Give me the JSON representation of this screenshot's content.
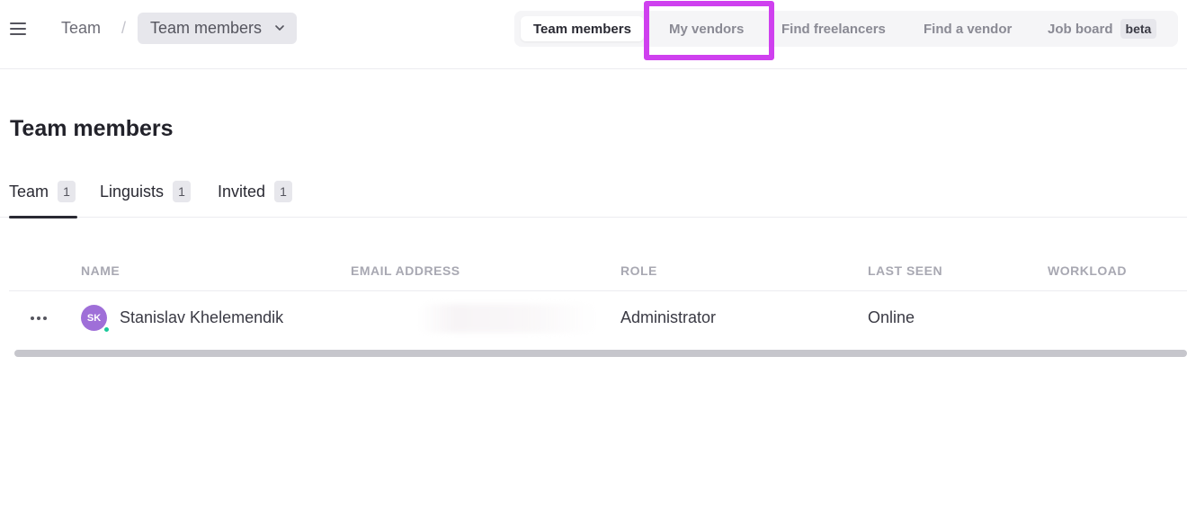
{
  "header": {
    "breadcrumb_root": "Team",
    "breadcrumb_separator": "/",
    "breadcrumb_current": "Team members",
    "nav": [
      {
        "label": "Team members",
        "active": true
      },
      {
        "label": "My vendors",
        "active": false
      },
      {
        "label": "Find freelancers",
        "active": false
      },
      {
        "label": "Find a vendor",
        "active": false
      },
      {
        "label": "Job board",
        "active": false,
        "badge": "beta"
      }
    ],
    "highlight_color": "#cf40ef"
  },
  "page": {
    "title": "Team members",
    "tabs": [
      {
        "label": "Team",
        "count": "1",
        "active": true
      },
      {
        "label": "Linguists",
        "count": "1",
        "active": false
      },
      {
        "label": "Invited",
        "count": "1",
        "active": false
      }
    ]
  },
  "table": {
    "columns": [
      "NAME",
      "EMAIL ADDRESS",
      "ROLE",
      "LAST SEEN",
      "WORKLOAD"
    ],
    "rows": [
      {
        "initials": "SK",
        "name": "Stanislav Khelemendik",
        "email": "",
        "role": "Administrator",
        "last_seen": "Online",
        "workload": "",
        "avatar_color": "#9f6fd8",
        "status_color": "#18c99a"
      }
    ]
  },
  "icons": {
    "menu": "hamburger-menu-icon",
    "dropdown": "chevron-down-icon",
    "row_actions": "more-horizontal-icon"
  }
}
